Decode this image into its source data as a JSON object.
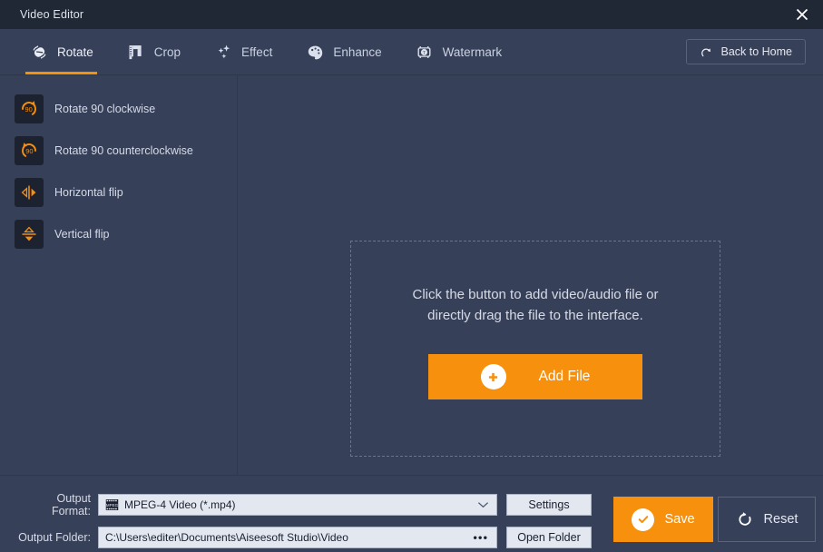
{
  "window": {
    "title": "Video Editor",
    "close_icon": "close-icon"
  },
  "tabs": [
    {
      "label": "Rotate",
      "icon": "rotate-icon",
      "active": true
    },
    {
      "label": "Crop",
      "icon": "crop-icon",
      "active": false
    },
    {
      "label": "Effect",
      "icon": "effect-stars-icon",
      "active": false
    },
    {
      "label": "Enhance",
      "icon": "palette-icon",
      "active": false
    },
    {
      "label": "Watermark",
      "icon": "watermark-icon",
      "active": false
    }
  ],
  "back_home": {
    "label": "Back to Home",
    "icon": "redo-arrow-icon"
  },
  "sidebar": {
    "items": [
      {
        "label": "Rotate 90 clockwise",
        "icon": "rotate-cw-90-icon"
      },
      {
        "label": "Rotate 90 counterclockwise",
        "icon": "rotate-ccw-90-icon"
      },
      {
        "label": "Horizontal flip",
        "icon": "flip-horizontal-icon"
      },
      {
        "label": "Vertical flip",
        "icon": "flip-vertical-icon"
      }
    ]
  },
  "dropzone": {
    "line1": "Click the button to add video/audio file or",
    "line2": "directly drag the file to the interface.",
    "add_button": {
      "label": "Add File",
      "icon": "plus-circle-icon"
    }
  },
  "bottom": {
    "format_label": "Output Format:",
    "format_value": "MPEG-4 Video (*.mp4)",
    "format_icon": "film-strip-icon",
    "format_chevron": "chevron-down-icon",
    "settings_label": "Settings",
    "folder_label": "Output Folder:",
    "folder_value": "C:\\Users\\editer\\Documents\\Aiseesoft Studio\\Video",
    "folder_browse": "•••",
    "open_folder_label": "Open Folder",
    "save_label": "Save",
    "save_icon": "check-circle-icon",
    "reset_label": "Reset",
    "reset_icon": "refresh-icon"
  },
  "colors": {
    "accent": "#f7900d",
    "titlebar_bg": "#212835",
    "app_bg": "#374059",
    "icon_tile_bg": "#1c2230",
    "field_bg": "#e3e7f0"
  }
}
